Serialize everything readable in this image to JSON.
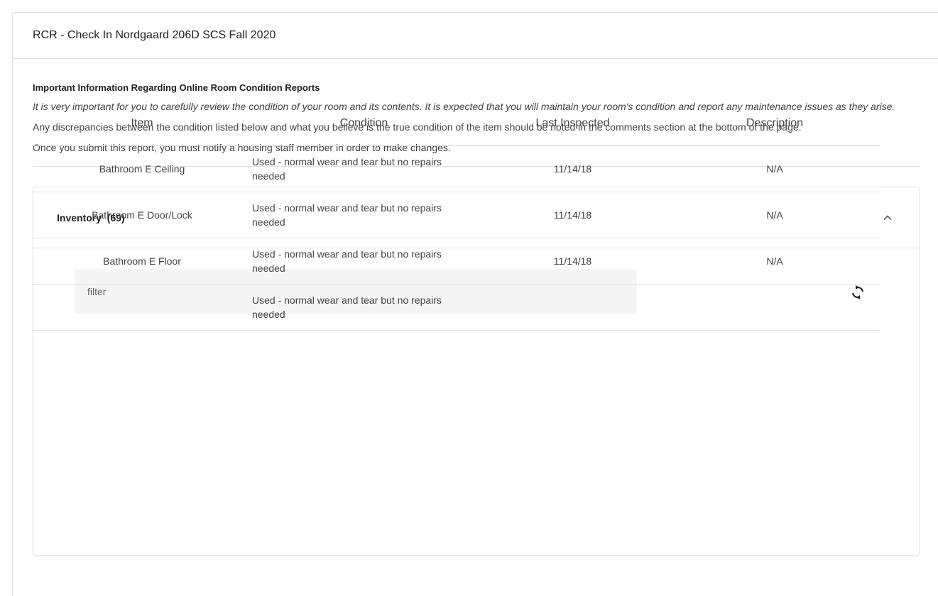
{
  "card": {
    "title": "RCR - Check In Nordgaard 206D SCS Fall 2020"
  },
  "info": {
    "heading": "Important Information Regarding Online Room Condition Reports",
    "paragraph_italic": "It is very important for you to carefully review the condition of your room and its contents. It is expected that you will maintain your room's condition and report any maintenance issues as they arise.",
    "paragraph_2": "Any discrepancies between the condition listed below and what you believe is the true condition of the item should be noted in the comments section at the bottom of the page.",
    "paragraph_3": "Once you submit this report, you must notify a housing staff member in order to make changes."
  },
  "inventory": {
    "label": "Inventory",
    "count": "(69)",
    "filter_placeholder": "filter",
    "columns": [
      "Item",
      "Condition",
      "Last Inspected",
      "Description"
    ],
    "rows": [
      {
        "item": "Bathroom E Ceiling",
        "condition": "Used - normal wear and tear but no repairs needed",
        "last_inspected": "11/14/18",
        "description": "N/A"
      },
      {
        "item": "Bathroom E Door/Lock",
        "condition": "Used - normal wear and tear but no repairs needed",
        "last_inspected": "11/14/18",
        "description": "N/A"
      },
      {
        "item": "Bathroom E Floor",
        "condition": "Used - normal wear and tear but no repairs needed",
        "last_inspected": "11/14/18",
        "description": "N/A"
      },
      {
        "item": "",
        "condition": "Used - normal wear and tear but no repairs needed",
        "last_inspected": "",
        "description": ""
      }
    ]
  },
  "icons": {
    "collapse": "chevron-up-icon",
    "refresh": "refresh-icon"
  }
}
